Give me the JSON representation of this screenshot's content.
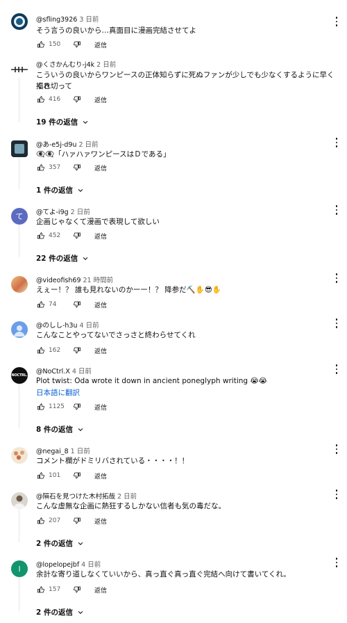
{
  "ui": {
    "reply_label": "返信",
    "translate_label": "日本語に翻訳"
  },
  "comments": [
    {
      "author": "@sfling3926",
      "time": "3 日前",
      "lines": [
        "そう言うの良いから…真面目に漫画完結させてよ"
      ],
      "likes": "150",
      "avatar": "ring-avatar",
      "menu": true,
      "replies": null
    },
    {
      "author": "@くさかんむり-j4k",
      "time": "2 日前",
      "lines": [
        "こういうの良いからワンピースの正体知らずに死ぬファンが少しでも少なくするように早く描き切って",
        "くれ"
      ],
      "likes": "416",
      "avatar": "stick-avatar",
      "menu": false,
      "replies": "19 件の返信"
    },
    {
      "author": "@あ-e5j-d9u",
      "time": "2 日前",
      "lines": [
        "👁‍🗨👁‍🗨「ハァハァワンピースはＤである」"
      ],
      "likes": "357",
      "avatar": "dark-avatar",
      "menu": true,
      "replies": "1 件の返信"
    },
    {
      "author": "@てよ-i9g",
      "time": "2 日前",
      "lines": [
        "企画じゃなくて漫画で表現して欲しい"
      ],
      "likes": "452",
      "avatar": "letter-avatar",
      "avatar_letter": "て",
      "menu": true,
      "replies": "22 件の返信"
    },
    {
      "author": "@videofish69",
      "time": "21 時間前",
      "lines": [
        "えぇー！？ 誰も見れないのかーー！？ 降参だ⛏️✋😎✋"
      ],
      "likes": "74",
      "avatar": "photo-avatar",
      "menu": true,
      "replies": null
    },
    {
      "author": "@のしし-h3u",
      "time": "4 日前",
      "lines": [
        "こんなことやってないでさっさと終わらせてくれ"
      ],
      "likes": "162",
      "avatar": "default-avatar",
      "menu": true,
      "replies": null
    },
    {
      "author": "@NoCtrl.X",
      "time": "4 日前",
      "lines": [
        "Plot twist: Oda wrote it down in ancient poneglyph writing 😭😭"
      ],
      "translate": true,
      "likes": "1125",
      "avatar": "noctrl-avatar",
      "avatar_text": "NOCTRL.",
      "menu": true,
      "replies": "8 件の返信"
    },
    {
      "author": "@negai_8",
      "time": "1 日前",
      "lines": [
        "コメント欄がドミリバされている・・・・！！"
      ],
      "likes": "101",
      "avatar": "group-avatar",
      "menu": true,
      "replies": null
    },
    {
      "author": "@隕石を見つけた木村拓哉",
      "time": "2 日前",
      "lines": [
        "こんな虚無な企画に熱狂するしかない信者も気の毒だな。"
      ],
      "likes": "207",
      "avatar": "person-avatar",
      "menu": true,
      "replies": "2 件の返信"
    },
    {
      "author": "@lopelopejbf",
      "time": "4 日前",
      "lines": [
        "余計な寄り道しなくていいから、真っ直ぐ真っ直ぐ完結へ向けて書いてくれ。"
      ],
      "likes": "157",
      "avatar": "letter-avatar",
      "avatar_letter": "l",
      "menu": true,
      "replies": "2 件の返信"
    }
  ],
  "colors": {
    "link": "#065fd4",
    "meta": "#606060",
    "divider": "#e5e5e5",
    "avatar_purple": "#5c6bc0",
    "avatar_green": "#12946f",
    "avatar_blue": "#6a9fe8"
  }
}
